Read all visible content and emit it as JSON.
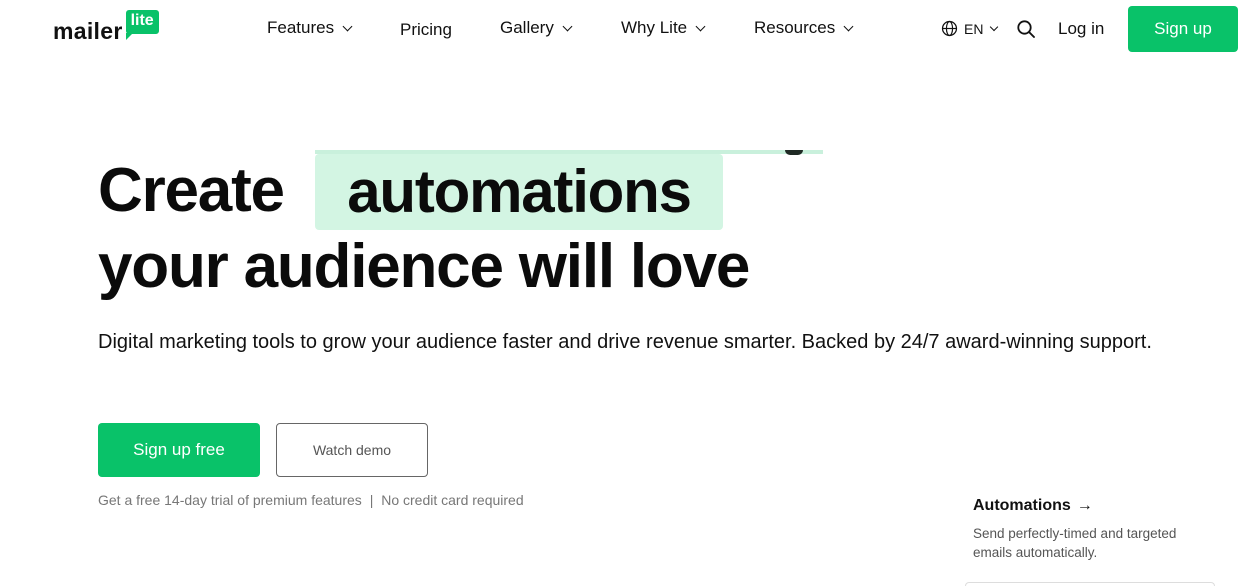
{
  "brand": {
    "word": "mailer",
    "badge": "lite",
    "accent": "#09c269",
    "highlight": "#d3f5e3"
  },
  "nav": {
    "items": [
      {
        "label": "Features",
        "has_dropdown": true
      },
      {
        "label": "Pricing",
        "has_dropdown": false
      },
      {
        "label": "Gallery",
        "has_dropdown": true
      },
      {
        "label": "Why Lite",
        "has_dropdown": true
      },
      {
        "label": "Resources",
        "has_dropdown": true
      }
    ],
    "language": "EN",
    "login": "Log in",
    "signup": "Sign up"
  },
  "hero": {
    "line1_prefix": "Create",
    "highlight_word": "automations",
    "line2": "your audience will love",
    "subtitle": "Digital marketing tools to grow your audience faster and drive revenue smarter. Backed by 24/7 award-winning support.",
    "primary_cta": "Sign up free",
    "secondary_cta": "Watch demo",
    "note_left": "Get a free 14-day trial of premium features",
    "note_sep": "|",
    "note_right": "No credit card required"
  },
  "feature_card": {
    "title": "Automations",
    "arrow": "→",
    "description": "Send perfectly-timed and targeted emails automatically."
  }
}
